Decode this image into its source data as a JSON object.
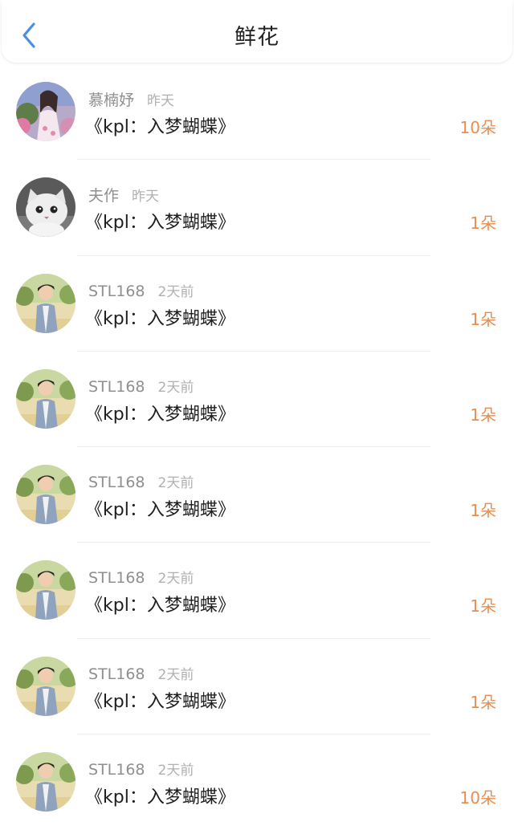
{
  "header": {
    "title": "鲜花",
    "back_icon": "chevron-left-icon",
    "accent_color": "#4a90e2"
  },
  "colors": {
    "count": "#e98d4f",
    "username": "#8f8f8f",
    "time": "#b0b0b0",
    "title": "#1e1e1e"
  },
  "items": [
    {
      "avatar": "avatar-girl-flowers",
      "username": "慕楠妤",
      "time": "昨天",
      "title": "《kpl：入梦蝴蝶》",
      "count": "10朵"
    },
    {
      "avatar": "avatar-white-cat",
      "username": "夫作",
      "time": "昨天",
      "title": "《kpl：入梦蝴蝶》",
      "count": "1朵"
    },
    {
      "avatar": "avatar-boy-outdoor",
      "username": "STL168",
      "time": "2天前",
      "title": "《kpl：入梦蝴蝶》",
      "count": "1朵"
    },
    {
      "avatar": "avatar-boy-outdoor",
      "username": "STL168",
      "time": "2天前",
      "title": "《kpl：入梦蝴蝶》",
      "count": "1朵"
    },
    {
      "avatar": "avatar-boy-outdoor",
      "username": "STL168",
      "time": "2天前",
      "title": "《kpl：入梦蝴蝶》",
      "count": "1朵"
    },
    {
      "avatar": "avatar-boy-outdoor",
      "username": "STL168",
      "time": "2天前",
      "title": "《kpl：入梦蝴蝶》",
      "count": "1朵"
    },
    {
      "avatar": "avatar-boy-outdoor",
      "username": "STL168",
      "time": "2天前",
      "title": "《kpl：入梦蝴蝶》",
      "count": "1朵"
    },
    {
      "avatar": "avatar-boy-outdoor",
      "username": "STL168",
      "time": "2天前",
      "title": "《kpl：入梦蝴蝶》",
      "count": "10朵"
    }
  ]
}
